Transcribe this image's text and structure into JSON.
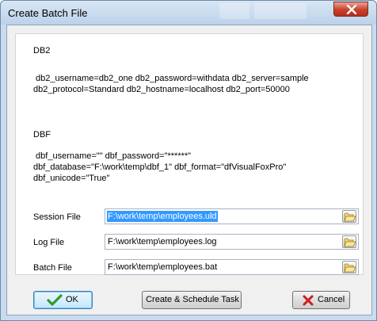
{
  "window": {
    "title": "Create Batch File"
  },
  "panel": {
    "db2": {
      "heading": "DB2",
      "line1": " db2_username=db2_one db2_password=withdata db2_server=sample",
      "line2": "db2_protocol=Standard db2_hostname=localhost db2_port=50000"
    },
    "dbf": {
      "heading": "DBF",
      "line1": " dbf_username=\"\" dbf_password=\"******\"",
      "line2": "dbf_database=\"F:\\work\\temp\\dbf_1\" dbf_format=\"dfVisualFoxPro\"",
      "line3": "dbf_unicode=\"True\""
    }
  },
  "fields": {
    "session": {
      "label": "Session File",
      "value": "F:\\work\\temp\\employees.uld"
    },
    "log": {
      "label": "Log File",
      "value": "F:\\work\\temp\\employees.log"
    },
    "batch": {
      "label": "Batch File",
      "value": "F:\\work\\temp\\employees.bat"
    }
  },
  "buttons": {
    "ok": "OK",
    "schedule": "Create & Schedule Task",
    "cancel": "Cancel"
  },
  "icons": {
    "close": "close-icon",
    "browse": "folder-open-icon",
    "ok": "checkmark-icon",
    "cancel": "x-icon"
  },
  "colors": {
    "selection": "#3399ff",
    "close_button": "#c9402b",
    "check": "#2e9a2e",
    "cancel_x": "#cc2020"
  }
}
